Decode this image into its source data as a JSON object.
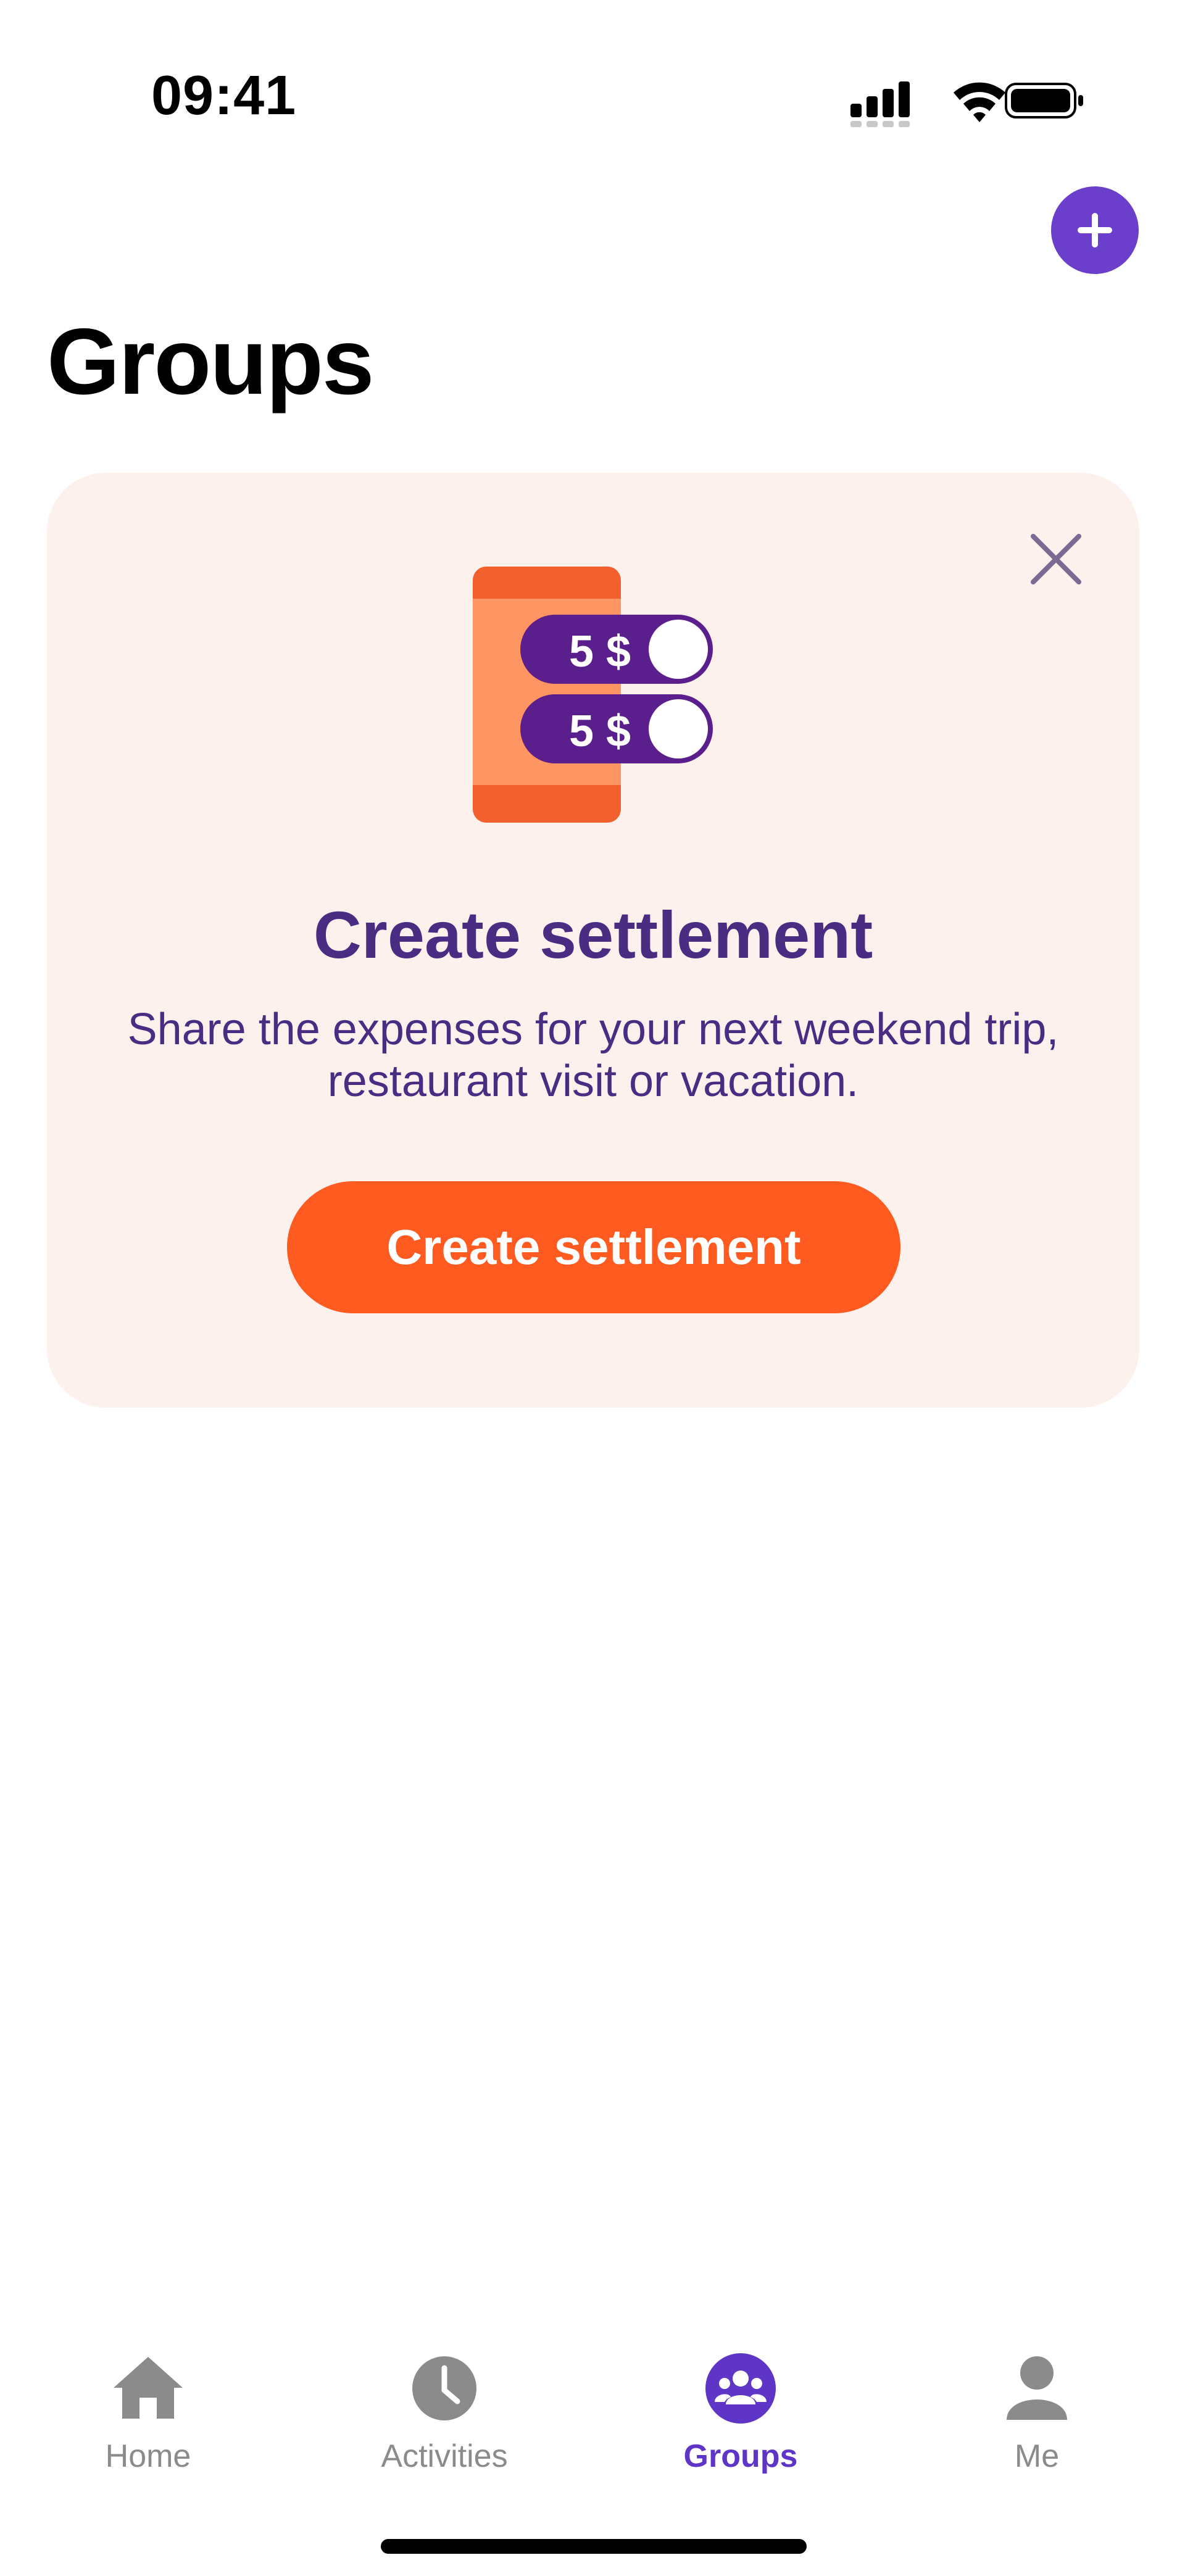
{
  "status_bar": {
    "time": "09:41"
  },
  "header": {
    "title": "Groups",
    "add_icon": "plus-icon"
  },
  "promo_card": {
    "illustration": {
      "amount_1": "5 $",
      "amount_2": "5 $"
    },
    "title": "Create settlement",
    "description": "Share the expenses for your next weekend trip, restaurant visit or vacation.",
    "button_label": "Create settlement",
    "close_icon": "close-icon"
  },
  "tab_bar": {
    "items": [
      {
        "label": "Home",
        "icon": "home-icon",
        "active": false
      },
      {
        "label": "Activities",
        "icon": "clock-icon",
        "active": false
      },
      {
        "label": "Groups",
        "icon": "groups-icon",
        "active": true
      },
      {
        "label": "Me",
        "icon": "person-icon",
        "active": false
      }
    ]
  },
  "colors": {
    "accent": "#6b3fcc",
    "primary_button": "#ff5a1f",
    "card_background": "#fdf1ee",
    "card_text": "#4a2d83",
    "tab_inactive": "#8b8b8b",
    "tab_active": "#5f35c8"
  }
}
